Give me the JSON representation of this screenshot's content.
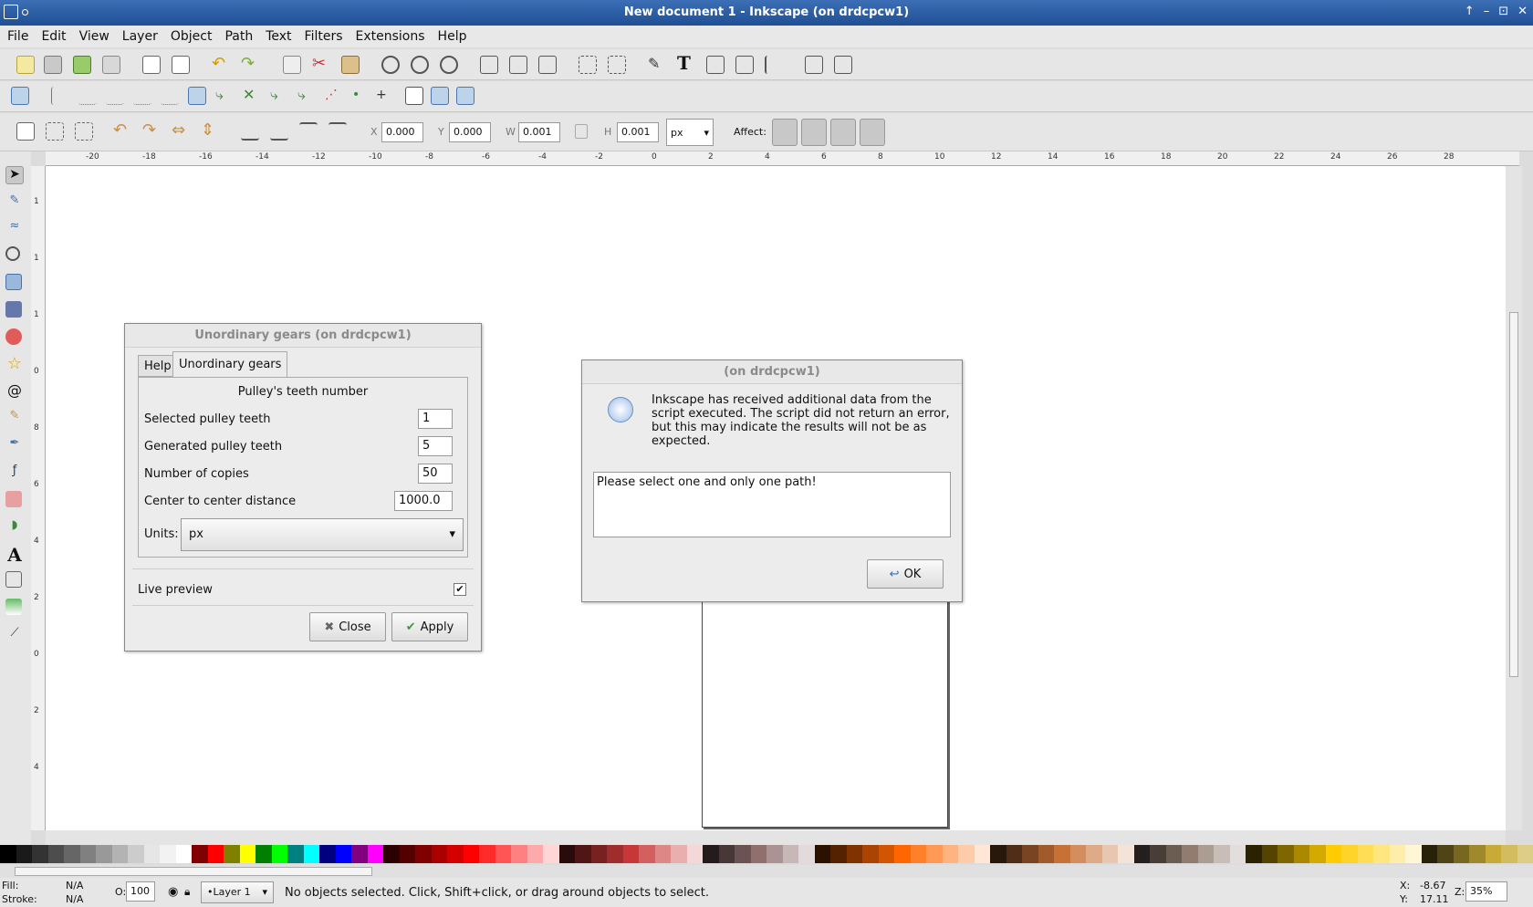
{
  "window": {
    "title": "New document 1 - Inkscape (on drdcpcw1)",
    "controls": [
      "↑",
      "–",
      "⊡",
      "✕"
    ]
  },
  "menu": [
    "File",
    "Edit",
    "View",
    "Layer",
    "Object",
    "Path",
    "Text",
    "Filters",
    "Extensions",
    "Help"
  ],
  "selectbar": {
    "x_label": "X",
    "x_value": "0.000",
    "y_label": "Y",
    "y_value": "0.000",
    "w_label": "W",
    "w_value": "0.001",
    "h_label": "H",
    "h_value": "0.001",
    "unit": "px",
    "affect_label": "Affect:"
  },
  "ruler_h": [
    "-20",
    "-18",
    "-16",
    "-14",
    "-12",
    "-10",
    "-8",
    "-6",
    "-4",
    "-2",
    "0",
    "2",
    "4",
    "6",
    "8",
    "10",
    "12",
    "14",
    "16",
    "18",
    "20",
    "22",
    "24",
    "26",
    "28"
  ],
  "ruler_v": [
    "1",
    "1",
    "1",
    "0",
    "8",
    "6",
    "4",
    "2",
    "0",
    "2",
    "4"
  ],
  "gears_dialog": {
    "title": "Unordinary gears (on drdcpcw1)",
    "tabs": [
      "Help",
      "Unordinary gears"
    ],
    "heading": "Pulley's teeth number",
    "fields": [
      {
        "label": "Selected pulley teeth",
        "value": "1"
      },
      {
        "label": "Generated pulley teeth",
        "value": "5"
      },
      {
        "label": "Number of copies",
        "value": "50"
      },
      {
        "label": "Center to center distance",
        "value": "1000.0"
      }
    ],
    "units_label": "Units:",
    "units_value": "px",
    "live_preview": "Live preview",
    "close": "Close",
    "apply": "Apply"
  },
  "msg_dialog": {
    "title": "(on drdcpcw1)",
    "message": "Inkscape has received additional data from the script executed.  The script did not return an error, but this may indicate the results will not be as expected.",
    "output": "Please select one and only one path!",
    "ok": "OK"
  },
  "status": {
    "fill_label": "Fill:",
    "fill_value": "N/A",
    "stroke_label": "Stroke:",
    "stroke_value": "N/A",
    "opacity_label": "O:",
    "opacity_value": "100",
    "layer": "•Layer 1",
    "message": "No objects selected. Click, Shift+click, or drag around objects to select.",
    "x_label": "X:",
    "x_value": "-8.67",
    "y_label": "Y:",
    "y_value": "17.11",
    "zoom_label": "Z:",
    "zoom_value": "35%"
  },
  "palette": [
    "#000000",
    "#1a1a1a",
    "#333333",
    "#4d4d4d",
    "#666666",
    "#808080",
    "#999999",
    "#b3b3b3",
    "#cccccc",
    "#e6e6e6",
    "#f2f2f2",
    "#ffffff",
    "#800000",
    "#ff0000",
    "#808000",
    "#ffff00",
    "#008000",
    "#00ff00",
    "#008080",
    "#00ffff",
    "#000080",
    "#0000ff",
    "#800080",
    "#ff00ff",
    "#2b0000",
    "#550000",
    "#800000",
    "#aa0000",
    "#d40000",
    "#ff0000",
    "#ff2a2a",
    "#ff5555",
    "#ff8080",
    "#ffaaaa",
    "#ffd5d5",
    "#280b0b",
    "#501616",
    "#782121",
    "#a02c2c",
    "#c83737",
    "#d35f5f",
    "#de8787",
    "#e9afaf",
    "#f4d7d7",
    "#241c1c",
    "#483737",
    "#6c5353",
    "#916f6f",
    "#ac9393",
    "#c8b7b7",
    "#e3dbdb",
    "#2b1100",
    "#552200",
    "#803300",
    "#aa4400",
    "#d45500",
    "#ff6600",
    "#ff7f2a",
    "#ff9955",
    "#ffb380",
    "#ffccaa",
    "#ffe6d5",
    "#28170b",
    "#502d16",
    "#784421",
    "#a05a2c",
    "#c87137",
    "#d38d5f",
    "#deaa87",
    "#e9c6af",
    "#f4e3d7",
    "#241f1c",
    "#483e37",
    "#6c5d53",
    "#917c6f",
    "#ac9d93",
    "#c8beb7",
    "#e3dedb",
    "#2b2200",
    "#554400",
    "#806600",
    "#aa8800",
    "#d4aa00",
    "#ffcc00",
    "#ffd42a",
    "#ffdd55",
    "#ffe680",
    "#ffeeaa",
    "#fff6d5",
    "#28220b",
    "#504416",
    "#786721",
    "#a0892c",
    "#c8ab37",
    "#d3bc5f",
    "#decd87"
  ]
}
